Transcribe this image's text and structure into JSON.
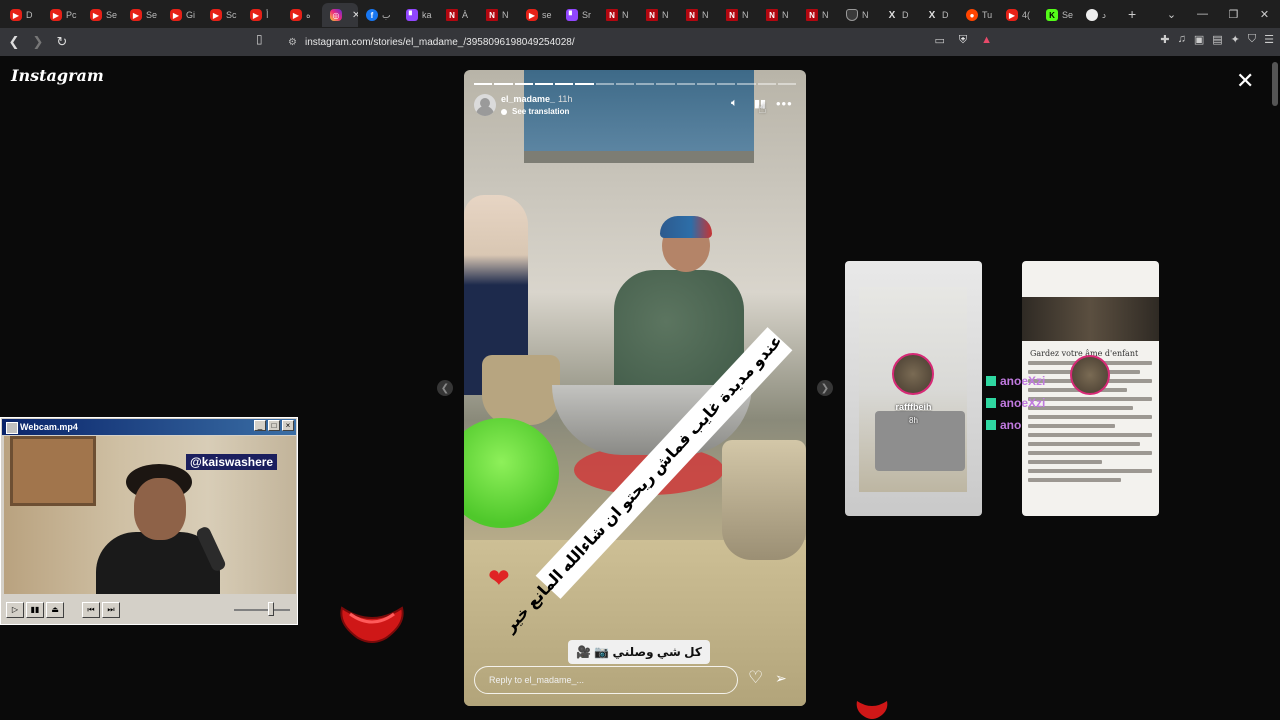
{
  "browser": {
    "tabs": [
      {
        "icon": "youtube-icon",
        "label": "D"
      },
      {
        "icon": "youtube-icon",
        "label": "Pc"
      },
      {
        "icon": "youtube-icon",
        "label": "Se"
      },
      {
        "icon": "youtube-icon",
        "label": "Se"
      },
      {
        "icon": "youtube-icon",
        "label": "Gi"
      },
      {
        "icon": "youtube-icon",
        "label": "Sc"
      },
      {
        "icon": "youtube-icon",
        "label": "أ"
      },
      {
        "icon": "youtube-icon",
        "label": "ه"
      },
      {
        "icon": "instagram-icon",
        "label": "",
        "active": true
      },
      {
        "icon": "facebook-icon",
        "label": "ب"
      },
      {
        "icon": "twitch-icon",
        "label": "ka"
      },
      {
        "icon": "netflix-icon",
        "label": "À"
      },
      {
        "icon": "netflix-icon",
        "label": "N"
      },
      {
        "icon": "youtube-icon",
        "label": "se"
      },
      {
        "icon": "twitch-icon",
        "label": "Sr"
      },
      {
        "icon": "netflix-icon",
        "label": "N"
      },
      {
        "icon": "netflix-icon",
        "label": "N"
      },
      {
        "icon": "netflix-icon",
        "label": "N"
      },
      {
        "icon": "netflix-icon",
        "label": "N"
      },
      {
        "icon": "netflix-icon",
        "label": "N"
      },
      {
        "icon": "netflix-icon",
        "label": "N"
      },
      {
        "icon": "shield-icon",
        "label": "N"
      },
      {
        "icon": "x-icon",
        "label": "D"
      },
      {
        "icon": "x-icon",
        "label": "D"
      },
      {
        "icon": "reddit-icon",
        "label": "Tu"
      },
      {
        "icon": "youtube-icon",
        "label": "4("
      },
      {
        "icon": "kick-icon",
        "label": "Se"
      },
      {
        "icon": "github-icon",
        "label": "د"
      }
    ],
    "address": "instagram.com/stories/el_madame_/3958096198049254028/"
  },
  "instagram": {
    "logo": "Instagram",
    "story": {
      "username": "el_madame_",
      "time": "11h",
      "translate": "See translation",
      "caption": "عندو مديدة غايب فماش ريحتو ان شاءالله المانع خير",
      "sticker": "كل شي وصلني 📷 🎥",
      "reply_placeholder": "Reply to el_madame_...",
      "progress_total": 16,
      "progress_done": 6
    },
    "side_stories": [
      {
        "username": "rafffbeih",
        "time": "8h"
      },
      {
        "username": "",
        "time": "",
        "heading": "Gardez votre âme d'enfant"
      }
    ],
    "chat_overlay": [
      "anoeXzi",
      "anoeXzi",
      "ano"
    ]
  },
  "webcam": {
    "title": "Webcam.mp4",
    "handle": "@kaiswashere"
  },
  "colors": {
    "accent_red": "#e62117",
    "story_ring": "#d62976",
    "win_title": "#0a246a"
  }
}
